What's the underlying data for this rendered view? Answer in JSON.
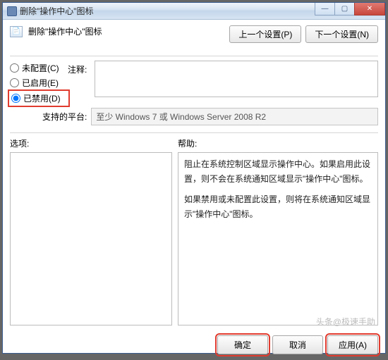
{
  "window": {
    "title": "删除\"操作中心\"图标"
  },
  "titlebar_buttons": {
    "min": "—",
    "max": "▢",
    "close": "✕"
  },
  "header": {
    "title": "删除\"操作中心\"图标"
  },
  "nav": {
    "prev": "上一个设置(P)",
    "next": "下一个设置(N)"
  },
  "radios": {
    "not_configured": "未配置(C)",
    "enabled": "已启用(E)",
    "disabled": "已禁用(D)",
    "selected": "disabled"
  },
  "labels": {
    "comment": "注释:",
    "platform": "支持的平台:",
    "options": "选项:",
    "help": "帮助:"
  },
  "platform_text": "至少 Windows 7 或 Windows Server 2008 R2",
  "help_text": {
    "p1": "阻止在系统控制区域显示操作中心。如果启用此设置，则不会在系统通知区域显示\"操作中心\"图标。",
    "p2": "如果禁用或未配置此设置，则将在系统通知区域显示\"操作中心\"图标。"
  },
  "footer": {
    "ok": "确定",
    "cancel": "取消",
    "apply": "应用(A)"
  },
  "watermark": "头条@极速手助"
}
